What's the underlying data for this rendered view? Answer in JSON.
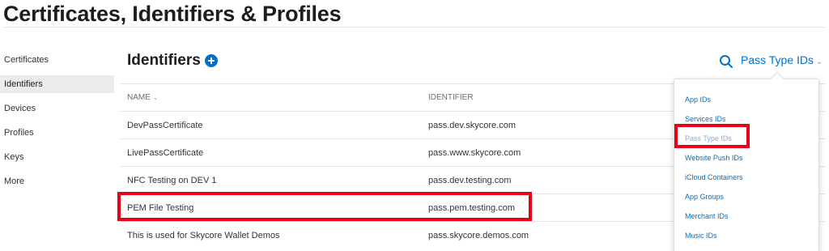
{
  "page": {
    "title": "Certificates, Identifiers & Profiles"
  },
  "sidebar": {
    "items": [
      {
        "label": "Certificates"
      },
      {
        "label": "Identifiers",
        "active": true
      },
      {
        "label": "Devices"
      },
      {
        "label": "Profiles"
      },
      {
        "label": "Keys"
      },
      {
        "label": "More"
      }
    ]
  },
  "main": {
    "heading": "Identifiers",
    "add_icon": "plus-circle-icon",
    "search_icon": "search-icon",
    "filter": {
      "selected": "Pass Type IDs",
      "chevron": "⌄"
    }
  },
  "table": {
    "columns": {
      "name": "NAME",
      "name_sort": "⌄",
      "identifier": "IDENTIFIER"
    },
    "rows": [
      {
        "name": "DevPassCertificate",
        "identifier": "pass.dev.skycore.com"
      },
      {
        "name": "LivePassCertificate",
        "identifier": "pass.www.skycore.com"
      },
      {
        "name": "NFC Testing on DEV 1",
        "identifier": "pass.dev.testing.com"
      },
      {
        "name": "PEM File Testing",
        "identifier": "pass.pem.testing.com"
      },
      {
        "name": "This is used for Skycore Wallet Demos",
        "identifier": "pass.skycore.demos.com"
      }
    ]
  },
  "dropdown": {
    "items": [
      {
        "label": "App IDs"
      },
      {
        "label": "Services IDs"
      },
      {
        "label": "Pass Type IDs",
        "selected": true
      },
      {
        "label": "Website Push IDs"
      },
      {
        "label": "iCloud Containers"
      },
      {
        "label": "App Groups"
      },
      {
        "label": "Merchant IDs"
      },
      {
        "label": "Music IDs"
      }
    ]
  },
  "colors": {
    "accent": "#0070c9",
    "annotation": "#e8001a",
    "active_sidebar_bg": "#ececec"
  }
}
